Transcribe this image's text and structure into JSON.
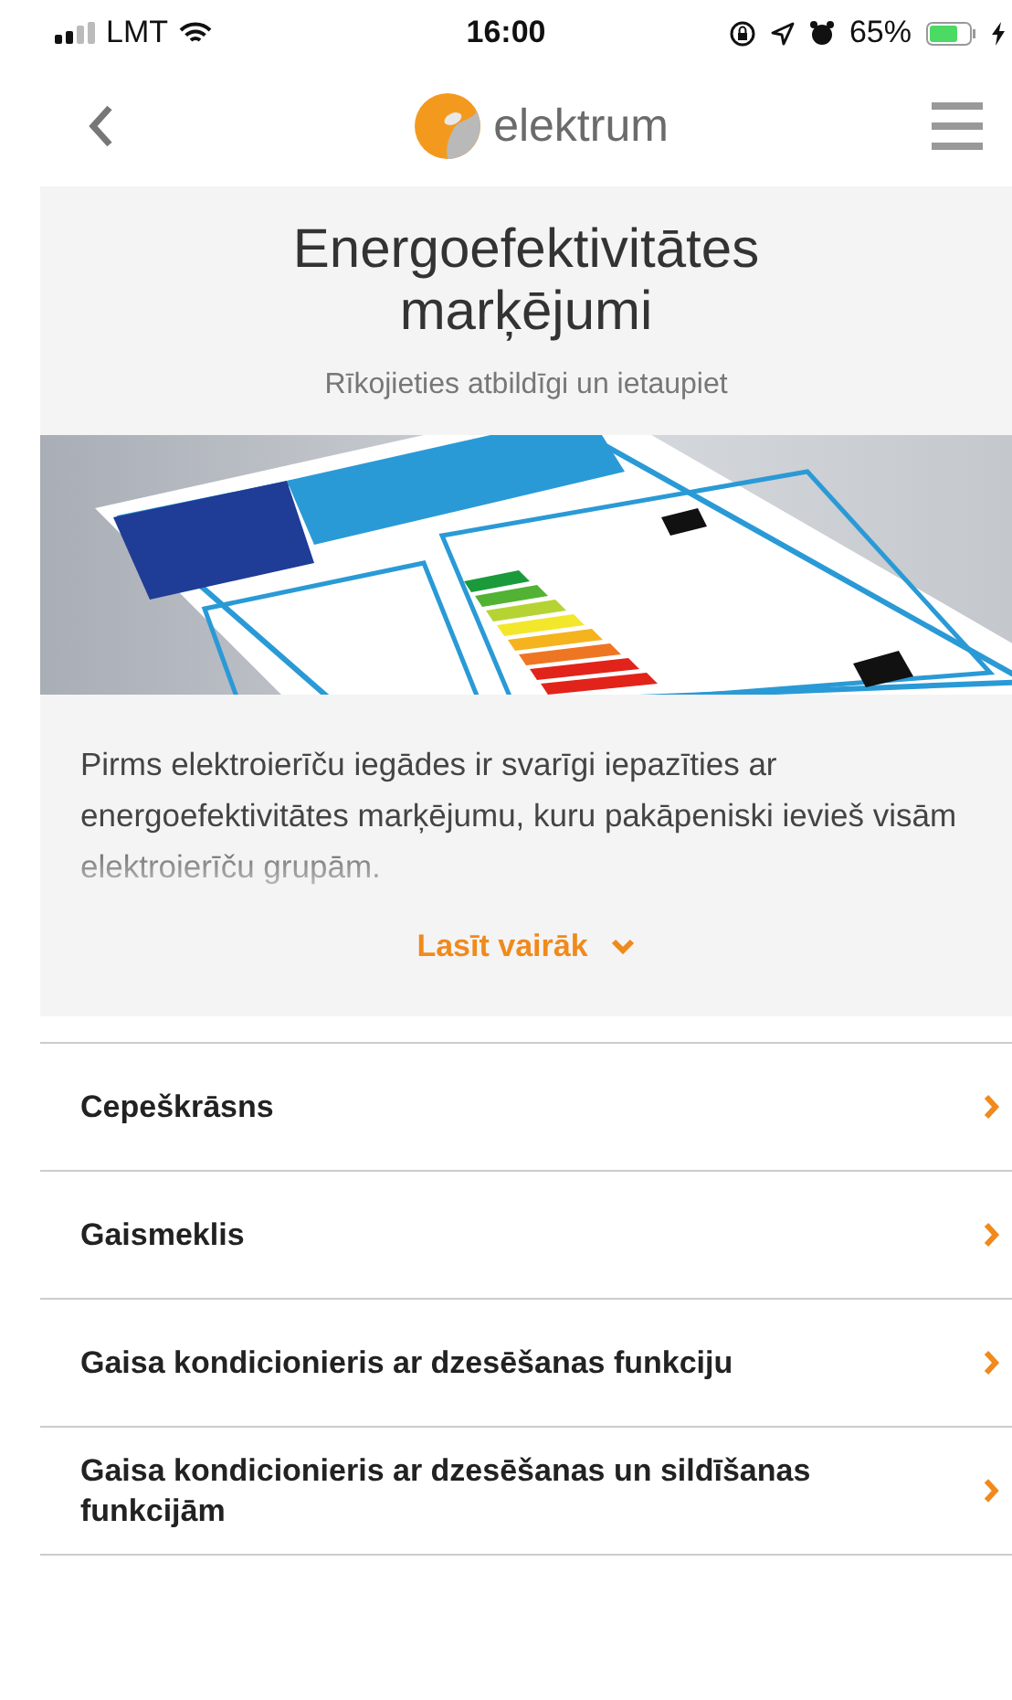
{
  "status_bar": {
    "carrier": "LMT",
    "time": "16:00",
    "battery": "65%"
  },
  "nav": {
    "logo_text": "elektrum"
  },
  "hero": {
    "title": "Energoefektivitātes marķējumi",
    "subtitle": "Rīkojieties atbildīgi un ietaupiet",
    "intro": "Pirms elektroierīču iegādes ir svarīgi iepazīties ar energoefektivitātes marķējumu, kuru pakāpeniski ievieš visām elektroierīču grupām.",
    "read_more": "Lasīt vairāk",
    "expanded": false
  },
  "categories": [
    {
      "label": "Cepeškrāsns"
    },
    {
      "label": "Gaismeklis"
    },
    {
      "label": "Gaisa kondicionieris ar dzesēšanas funkciju"
    },
    {
      "label": "Gaisa kondicionieris ar dzesēšanas un sildīšanas funkcijām"
    }
  ]
}
